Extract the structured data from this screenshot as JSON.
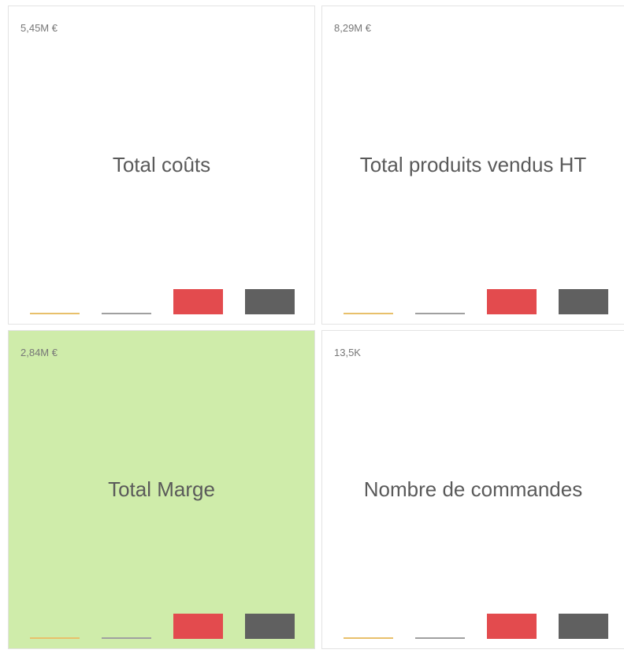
{
  "colors": {
    "bar_1": "#e8c06b",
    "bar_2": "#a0a0a0",
    "bar_3": "#e34b4e",
    "bar_4": "#606060",
    "tile_background": "#ffffff",
    "tile_highlight_background": "#cfecaa"
  },
  "tiles": [
    {
      "value": "5,45M €",
      "title": "Total coûts",
      "highlighted": false
    },
    {
      "value": "8,29M €",
      "title": "Total produits vendus HT",
      "highlighted": false
    },
    {
      "value": "2,84M €",
      "title": "Total Marge",
      "highlighted": true
    },
    {
      "value": "13,5K",
      "title": "Nombre de commandes",
      "highlighted": false
    }
  ],
  "chart_data": [
    {
      "type": "bar",
      "title": "Total coûts",
      "subtitle": "5,45M €",
      "series": [
        {
          "values": [
            0.1,
            0.2,
            1,
            1
          ]
        }
      ],
      "ylim": [
        0,
        1
      ]
    },
    {
      "type": "bar",
      "title": "Total produits vendus HT",
      "subtitle": "8,29M €",
      "series": [
        {
          "values": [
            0.1,
            0.2,
            1,
            1
          ]
        }
      ],
      "ylim": [
        0,
        1
      ]
    },
    {
      "type": "bar",
      "title": "Total Marge",
      "subtitle": "2,84M €",
      "series": [
        {
          "values": [
            0.1,
            0.2,
            1,
            1
          ]
        }
      ],
      "ylim": [
        0,
        1
      ]
    },
    {
      "type": "bar",
      "title": "Nombre de commandes",
      "subtitle": "13,5K",
      "series": [
        {
          "values": [
            0.1,
            0.2,
            1,
            1
          ]
        }
      ],
      "ylim": [
        0,
        1
      ]
    }
  ]
}
